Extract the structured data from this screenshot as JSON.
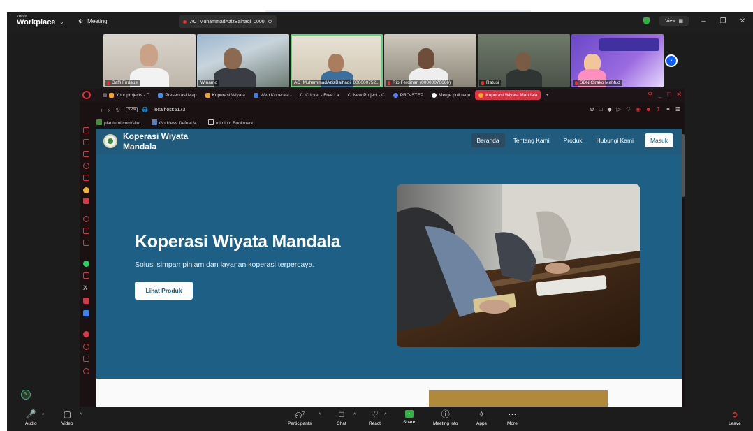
{
  "zoom": {
    "logo_small": "zoom",
    "logo_big": "Workplace",
    "meeting_label": "Meeting",
    "speaker_chip": "AC_MuhammadAzizBaihaqi_0000",
    "view_label": "View",
    "participants_count": "7"
  },
  "gallery": {
    "tiles": [
      {
        "name": "Daffi Firdaus"
      },
      {
        "name": "Winarno"
      },
      {
        "name": "AC_MuhammadAzizBaihaqi_000000752..."
      },
      {
        "name": "Rio Ferdinan (00000070666)"
      },
      {
        "name": "Ratusi"
      },
      {
        "name": "SDN Cirako Mahfud"
      }
    ]
  },
  "browser": {
    "tabs": [
      {
        "label": "Your projects - C",
        "color": "#f5a623"
      },
      {
        "label": "Presentasi Map",
        "color": "#4a90e2"
      },
      {
        "label": "Koperasi Wiyata",
        "color": "#e8a33d"
      },
      {
        "label": "Web Koperasi -",
        "color": "#3d7be8"
      },
      {
        "label": "Cricket - Free La",
        "color": "#ffffff"
      },
      {
        "label": "New Project - C",
        "color": "#ffffff"
      },
      {
        "label": "PRO-STEP",
        "color": "#5b7cfa"
      },
      {
        "label": "Merge pull requ",
        "color": "#ffffff"
      },
      {
        "label": "Koperasi Wiyata Mandala",
        "color": "#f5a623"
      }
    ],
    "vpn": "VPN",
    "url": "localhost:5173",
    "bookmarks": [
      "plantuml.com/site...",
      "Goddess Defeat V...",
      "mimi xd Bookmark..."
    ]
  },
  "site": {
    "name": "Koperasi Wiyata Mandala",
    "menu": [
      "Beranda",
      "Tentang Kami",
      "Produk",
      "Hubungi Kami"
    ],
    "login": "Masuk",
    "hero_title": "Koperasi Wiyata Mandala",
    "hero_subtitle": "Solusi simpan pinjam dan layanan koperasi terpercaya.",
    "hero_button": "Lihat Produk",
    "colors": {
      "primary": "#1e5f86",
      "nav": "#205a7c"
    }
  },
  "toolbar": {
    "audio": "Audio",
    "video": "Video",
    "participants": "Participants",
    "chat": "Chat",
    "react": "React",
    "share": "Share",
    "meeting_info": "Meeting info",
    "apps": "Apps",
    "more": "More",
    "leave": "Leave"
  }
}
